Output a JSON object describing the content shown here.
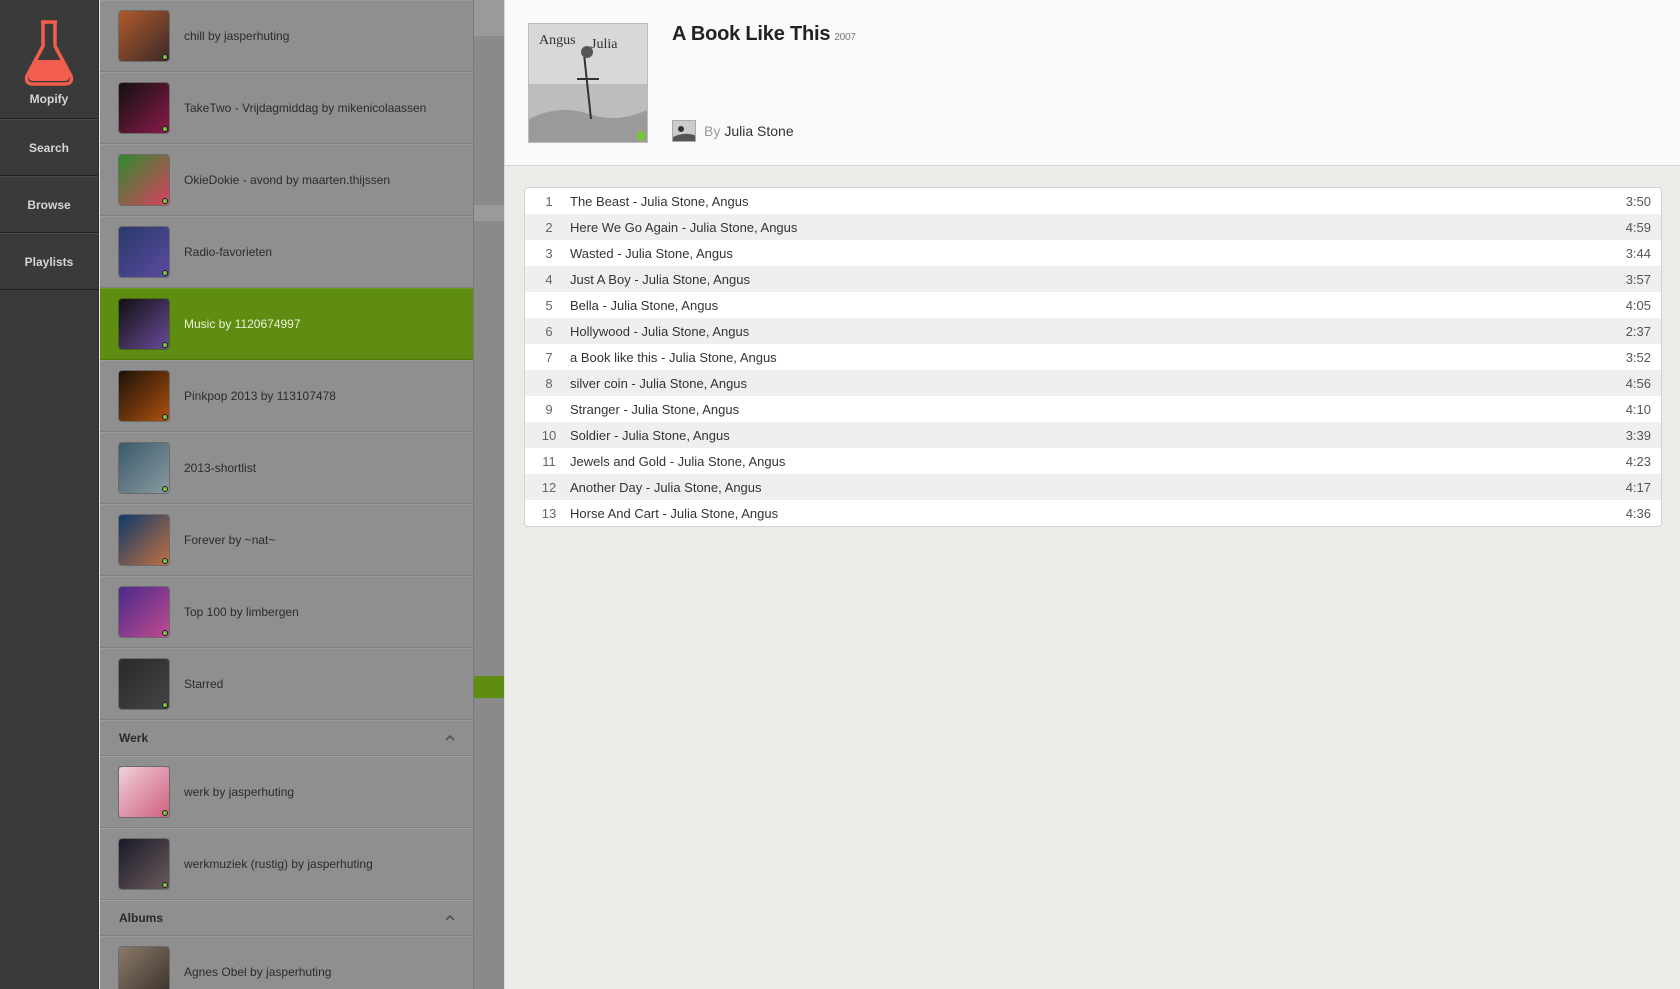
{
  "nav": {
    "logo_label": "Mopify",
    "items": [
      {
        "label": "Search"
      },
      {
        "label": "Browse"
      },
      {
        "label": "Playlists"
      }
    ]
  },
  "playlists": {
    "items": [
      {
        "name": "chill by jasperhuting",
        "colors": [
          "#b05a2a",
          "#3a2a2a"
        ]
      },
      {
        "name": "TakeTwo - Vrijdagmiddag by mikenicolaassen",
        "colors": [
          "#111111",
          "#8a1a4a"
        ]
      },
      {
        "name": "OkieDokie - avond by maarten.thijssen",
        "colors": [
          "#2e8b2e",
          "#d94060"
        ]
      },
      {
        "name": "Radio-favorieten",
        "colors": [
          "#2a3a6a",
          "#5a4aa0"
        ]
      },
      {
        "name": "Music by 1120674997",
        "colors": [
          "#111111",
          "#6a4a9a"
        ],
        "active": true
      },
      {
        "name": "Pinkpop 2013 by 113107478",
        "colors": [
          "#1a1208",
          "#b05010"
        ]
      },
      {
        "name": "2013-shortlist",
        "colors": [
          "#3a5a6a",
          "#8a9aa0"
        ]
      },
      {
        "name": "Forever by ~nat~",
        "colors": [
          "#103a6a",
          "#c07040"
        ]
      },
      {
        "name": "Top 100 by limbergen",
        "colors": [
          "#4a2a8a",
          "#c04a90"
        ]
      },
      {
        "name": "Starred",
        "colors": [
          "#2a2a2a",
          "#444444"
        ]
      }
    ],
    "sections": [
      {
        "title": "Werk",
        "items": [
          {
            "name": "werk by jasperhuting",
            "colors": [
              "#f0d0d8",
              "#d06080"
            ]
          },
          {
            "name": "werkmuziek (rustig) by jasperhuting",
            "colors": [
              "#1a1a2a",
              "#6a5a5a"
            ]
          }
        ]
      },
      {
        "title": "Albums",
        "items": [
          {
            "name": "Agnes Obel by jasperhuting",
            "colors": [
              "#8a7a6a",
              "#3a3028"
            ]
          }
        ]
      }
    ]
  },
  "album": {
    "title": "A Book Like This",
    "year": "2007",
    "by_label": "By",
    "artist": "Julia Stone"
  },
  "tracks": [
    {
      "num": "1",
      "title": "The Beast - Julia Stone, Angus",
      "time": "3:50"
    },
    {
      "num": "2",
      "title": "Here We Go Again - Julia Stone, Angus",
      "time": "4:59"
    },
    {
      "num": "3",
      "title": "Wasted - Julia Stone, Angus",
      "time": "3:44"
    },
    {
      "num": "4",
      "title": "Just A Boy - Julia Stone, Angus",
      "time": "3:57"
    },
    {
      "num": "5",
      "title": "Bella - Julia Stone, Angus",
      "time": "4:05"
    },
    {
      "num": "6",
      "title": "Hollywood - Julia Stone, Angus",
      "time": "2:37"
    },
    {
      "num": "7",
      "title": "a Book like this - Julia Stone, Angus",
      "time": "3:52"
    },
    {
      "num": "8",
      "title": "silver coin - Julia Stone, Angus",
      "time": "4:56"
    },
    {
      "num": "9",
      "title": "Stranger - Julia Stone, Angus",
      "time": "4:10"
    },
    {
      "num": "10",
      "title": "Soldier - Julia Stone, Angus",
      "time": "3:39"
    },
    {
      "num": "11",
      "title": "Jewels and Gold - Julia Stone, Angus",
      "time": "4:23"
    },
    {
      "num": "12",
      "title": "Another Day - Julia Stone, Angus",
      "time": "4:17"
    },
    {
      "num": "13",
      "title": "Horse And Cart - Julia Stone, Angus",
      "time": "4:36"
    }
  ],
  "colors": {
    "accent": "#5e8d12",
    "logo": "#f25e4e"
  }
}
